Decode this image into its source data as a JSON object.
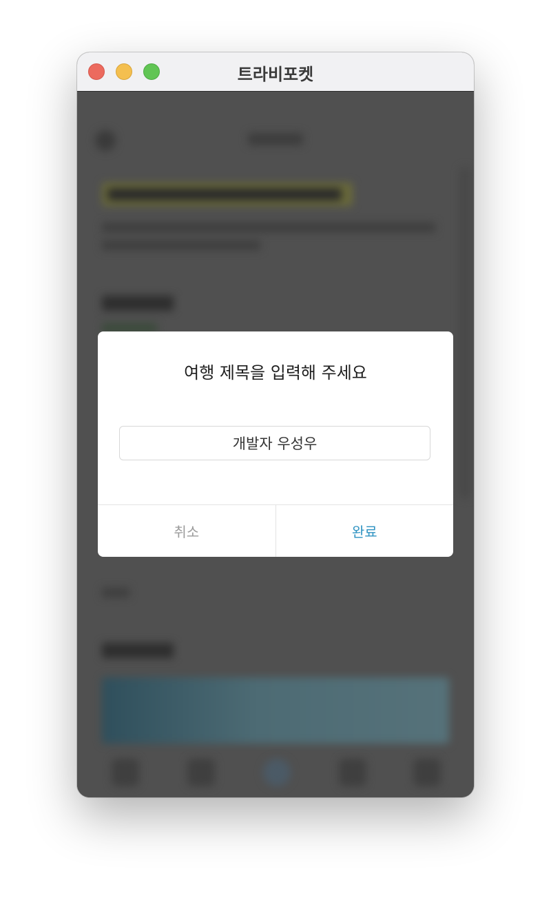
{
  "window": {
    "title": "트라비포켓"
  },
  "dialog": {
    "title": "여행 제목을 입력해 주세요",
    "input_value": "개발자 우성우",
    "cancel_label": "취소",
    "confirm_label": "완료"
  },
  "colors": {
    "accent": "#2f93c2",
    "cancel": "#9b9b9b",
    "overlay": "#505050"
  }
}
